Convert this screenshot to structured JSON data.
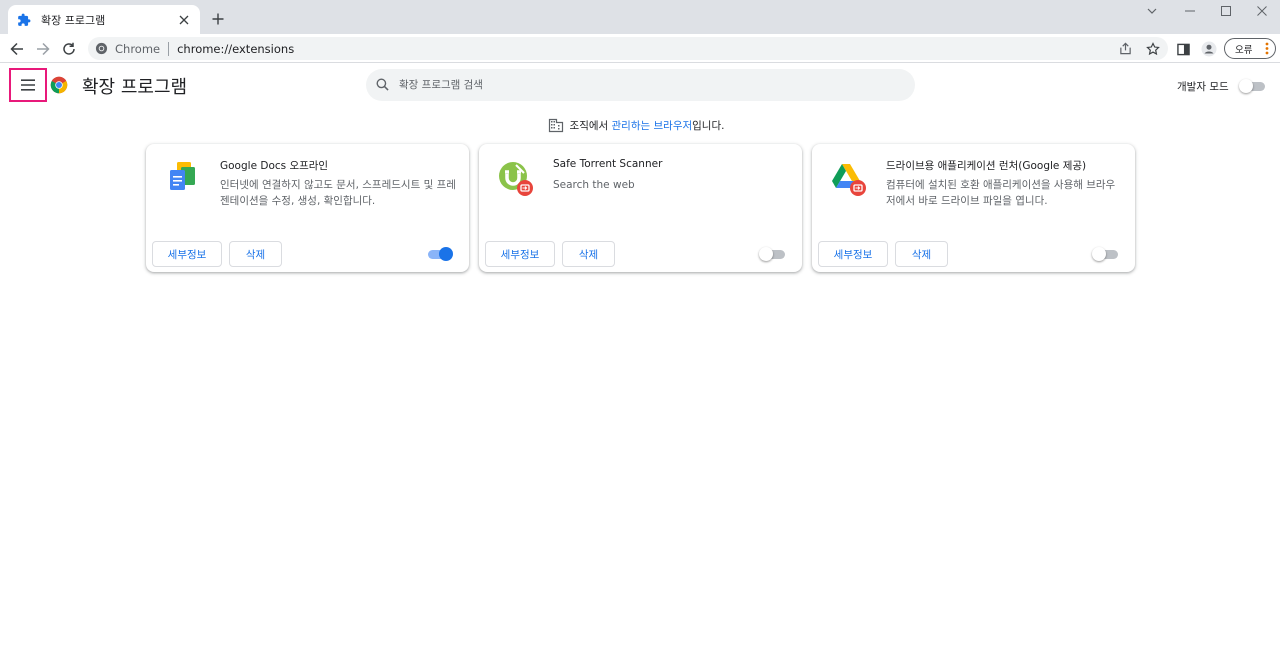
{
  "tab": {
    "title": "확장 프로그램"
  },
  "toolbar": {
    "site_name": "Chrome",
    "url": "chrome://extensions",
    "profile_label": "오류"
  },
  "header": {
    "title": "확장 프로그램",
    "search_placeholder": "확장 프로그램 검색",
    "dev_mode_label": "개발자 모드",
    "dev_mode_on": false
  },
  "managed_notice": {
    "prefix": "조직에서 ",
    "link": "관리하는 브라우저",
    "suffix": "입니다."
  },
  "extensions": [
    {
      "name": "Google Docs 오프라인",
      "description": "인터넷에 연결하지 않고도 문서, 스프레드시트 및 프레젠테이션을 수정, 생성, 확인합니다.",
      "details_label": "세부정보",
      "remove_label": "삭제",
      "enabled": true,
      "icon": "google-docs-offline-icon"
    },
    {
      "name": "Safe Torrent Scanner",
      "description": "Search the web",
      "details_label": "세부정보",
      "remove_label": "삭제",
      "enabled": false,
      "icon": "safe-torrent-scanner-icon"
    },
    {
      "name": "드라이브용 애플리케이션 런처(Google 제공)",
      "description": "컴퓨터에 설치된 호환 애플리케이션을 사용해 브라우저에서 바로 드라이브 파일을 엽니다.",
      "details_label": "세부정보",
      "remove_label": "삭제",
      "enabled": false,
      "icon": "google-drive-launcher-icon"
    }
  ],
  "colors": {
    "accent": "#1a73e8",
    "highlight_box": "#e8197a",
    "tabstrip": "#dee1e6"
  }
}
